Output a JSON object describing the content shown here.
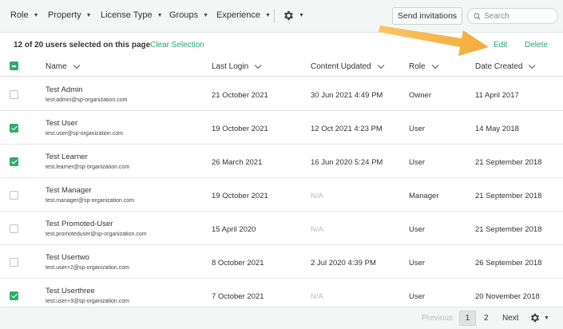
{
  "filters": {
    "role": "Role",
    "property": "Property",
    "license_type": "License Type",
    "groups": "Groups",
    "experience": "Experience",
    "caret": "▼"
  },
  "toolbar": {
    "send_invitations": "Send invitations",
    "search_placeholder": "Search"
  },
  "selection": {
    "count_text": "12 of 20 users selected on this page",
    "clear": "Clear Selection",
    "edit": "Edit",
    "delete": "Delete"
  },
  "columns": {
    "name": "Name",
    "last_login": "Last Login",
    "content_updated": "Content Updated",
    "role": "Role",
    "date_created": "Date Created"
  },
  "rows": [
    {
      "name": "Test Admin",
      "email": "test.admin@sp-organization.com",
      "last_login": "21 October 2021",
      "content_updated": "30 Jun 2021 4:49 PM",
      "role": "Owner",
      "date_created": "11 April 2017",
      "checked": false
    },
    {
      "name": "Test User",
      "email": "test.user@sp-organization.com",
      "last_login": "19 October 2021",
      "content_updated": "12 Oct 2021 4:23 PM",
      "role": "User",
      "date_created": "14 May 2018",
      "checked": true
    },
    {
      "name": "Test Learner",
      "email": "test.learner@sp-organization.com",
      "last_login": "26 March 2021",
      "content_updated": "16 Jun 2020 5:24 PM",
      "role": "User",
      "date_created": "21 September 2018",
      "checked": true
    },
    {
      "name": "Test Manager",
      "email": "test.manager@sp-organization.com",
      "last_login": "19 October 2021",
      "content_updated": "N/A",
      "role": "Manager",
      "date_created": "21 September 2018",
      "checked": false
    },
    {
      "name": "Test Promoted-User",
      "email": "test.promoteduser@sp-organization.com",
      "last_login": "15 April 2020",
      "content_updated": "N/A",
      "role": "User",
      "date_created": "21 September 2018",
      "checked": false
    },
    {
      "name": "Test Usertwo",
      "email": "test.user+2@sp-organization.com",
      "last_login": "8 October 2021",
      "content_updated": "2 Jul 2020 4:39 PM",
      "role": "User",
      "date_created": "26 September 2018",
      "checked": false
    },
    {
      "name": "Test Userthree",
      "email": "test.user+3@sp-organization.com",
      "last_login": "7 October 2021",
      "content_updated": "N/A",
      "role": "User",
      "date_created": "20 November 2018",
      "checked": true
    }
  ],
  "pagination": {
    "previous": "Previous",
    "page1": "1",
    "page2": "2",
    "next": "Next"
  },
  "colors": {
    "accent": "#2ead6a",
    "link": "#29a567",
    "arrow": "#f5b548"
  },
  "icons": [
    "search-icon",
    "gear-icon",
    "chevron-down-icon",
    "checkbox-icon",
    "arrow-annotation"
  ]
}
